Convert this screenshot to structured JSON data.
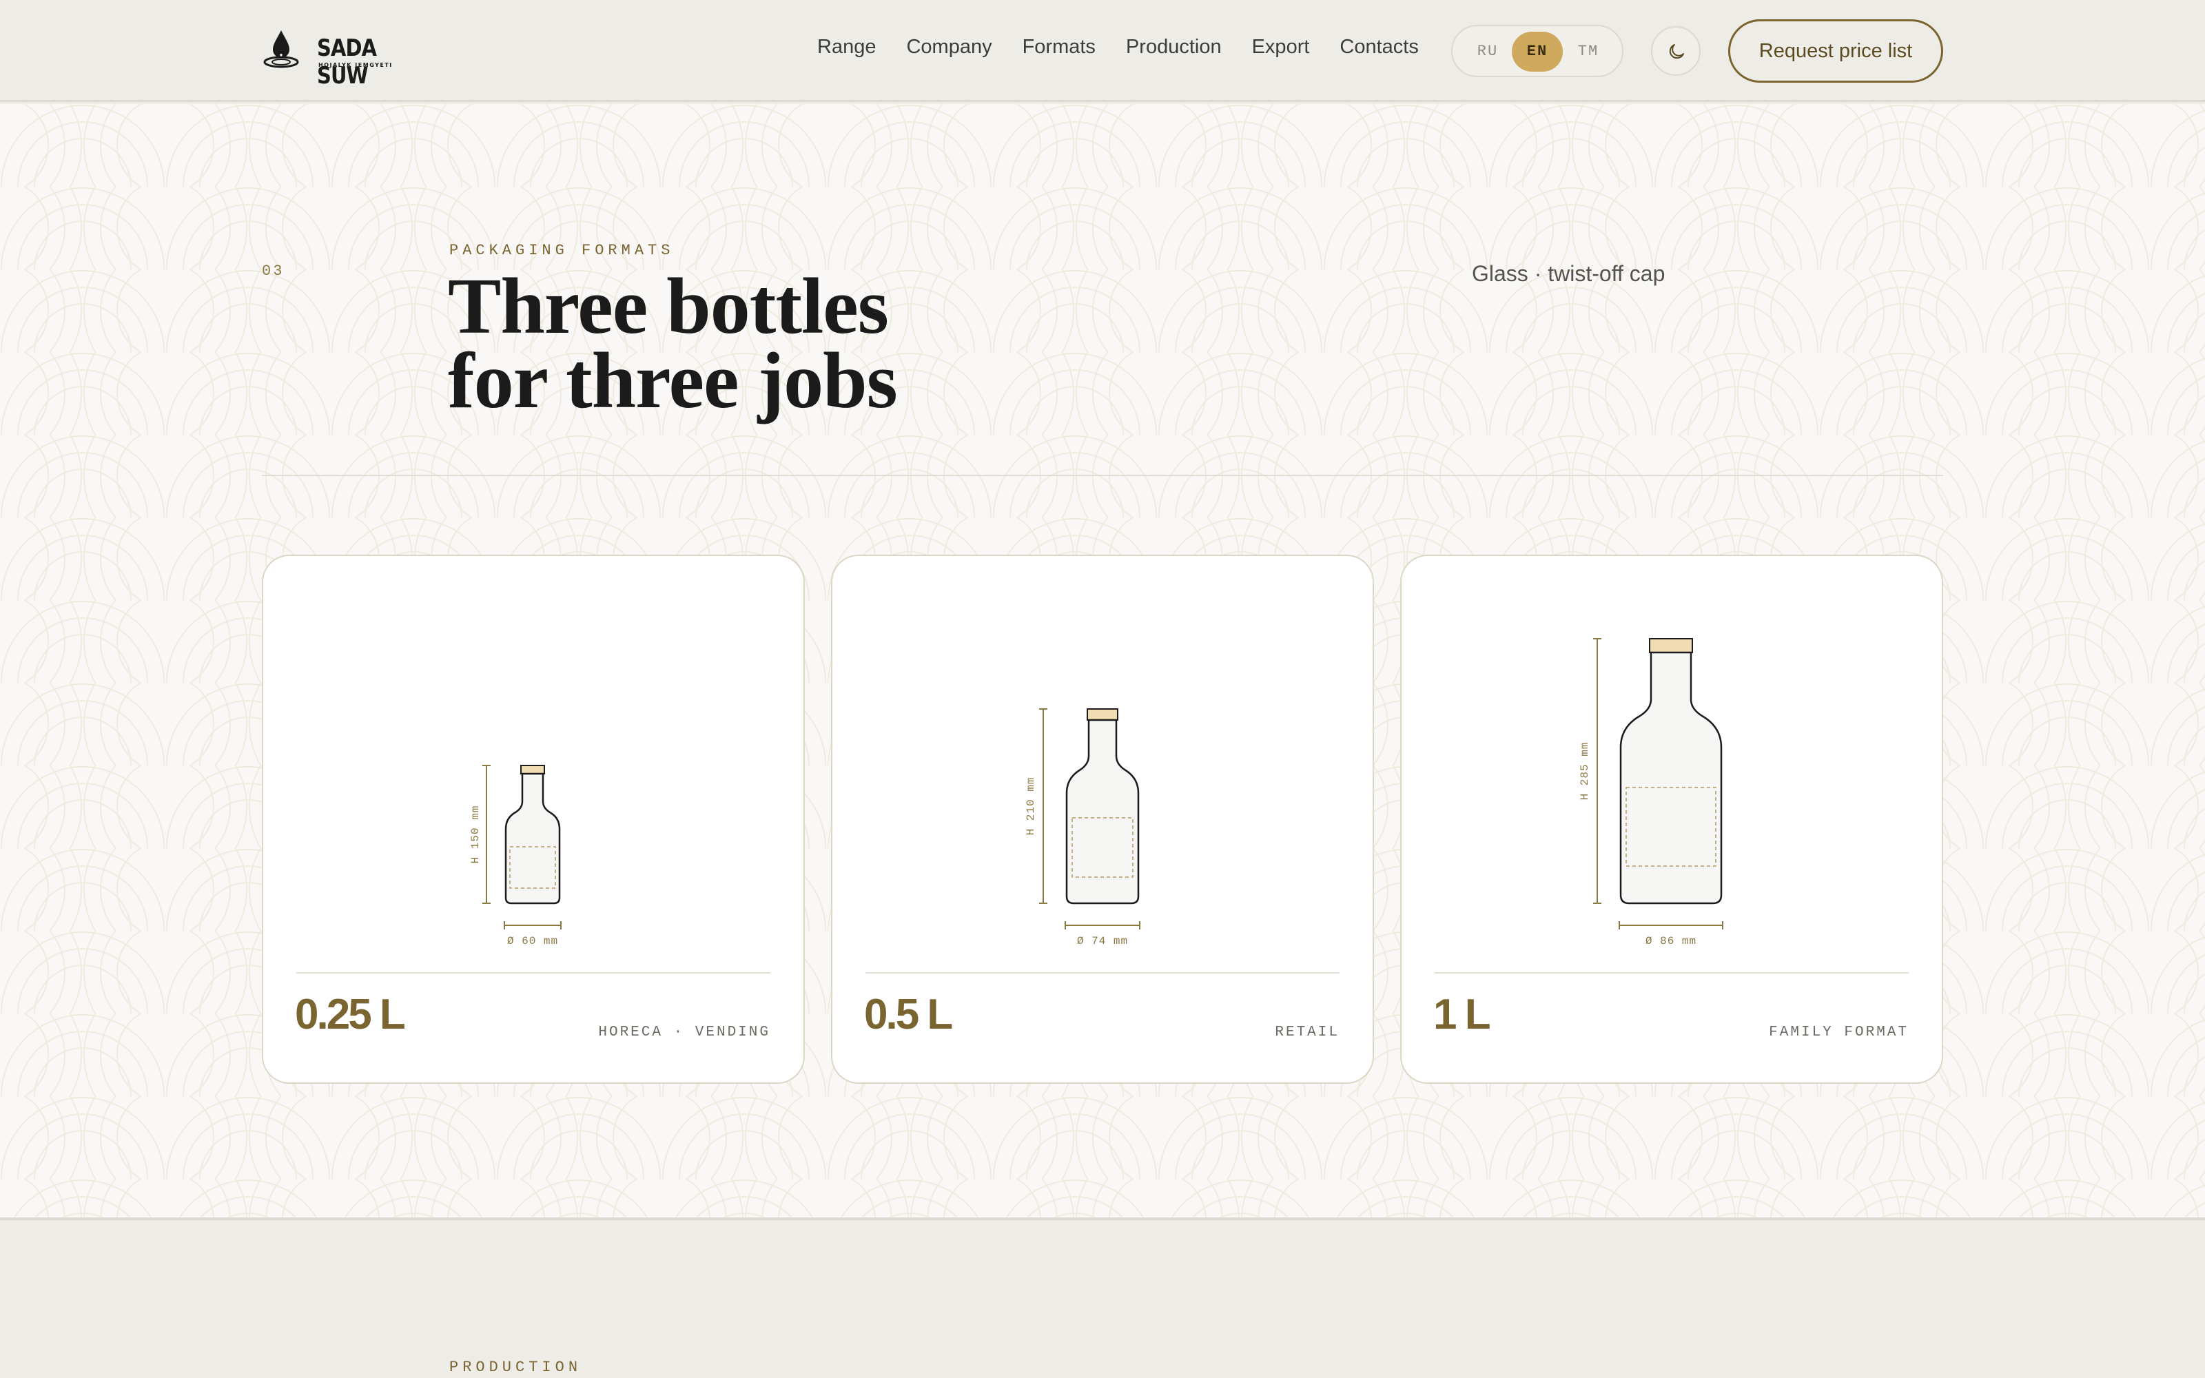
{
  "header": {
    "logo_word": "SADA SUW",
    "logo_sub": "HOJALYK JEMGYETI",
    "nav": [
      "Range",
      "Company",
      "Formats",
      "Production",
      "Export",
      "Contacts"
    ],
    "languages": [
      "RU",
      "EN",
      "TM"
    ],
    "active_language": "EN",
    "theme_icon": "moon-icon",
    "cta_label": "Request price list"
  },
  "section": {
    "number": "03",
    "eyebrow": "PACKAGING FORMATS",
    "headline_line1": "Three bottles",
    "headline_line2": "for three jobs",
    "aside": "Glass · twist-off cap"
  },
  "formats": [
    {
      "volume": "0.25 L",
      "use": "HORECA · VENDING",
      "height_label": "H 150 mm",
      "diameter_label": "Ø 60 mm"
    },
    {
      "volume": "0.5 L",
      "use": "RETAIL",
      "height_label": "H 210 mm",
      "diameter_label": "Ø 74 mm"
    },
    {
      "volume": "1 L",
      "use": "FAMILY FORMAT",
      "height_label": "H 285 mm",
      "diameter_label": "Ø 86 mm"
    }
  ],
  "next_section": {
    "eyebrow": "PRODUCTION"
  },
  "colors": {
    "accent": "#7a6531",
    "gold": "#cfaa5e",
    "cap": "#efdcb3",
    "background": "#eeece7"
  }
}
